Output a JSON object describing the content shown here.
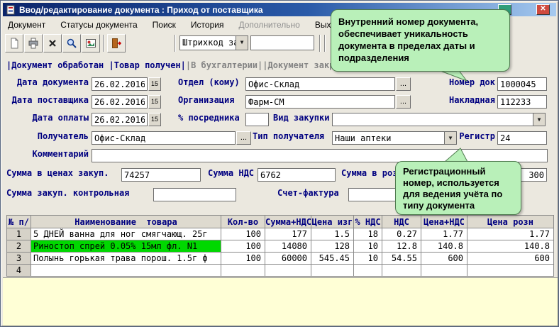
{
  "colors": {
    "label": "#000080",
    "highlight": "#00d800",
    "tooltip_bg": "#b9f0b9",
    "tooltip_border": "#4f7a4f",
    "panel": "#ffffd6",
    "flag_on": "#000080",
    "flag_off": "#848484"
  },
  "icons": {
    "dropdown_glyph": "▼",
    "close_glyph": "✕"
  },
  "window": {
    "title": "Ввод/редактирование документа : Приход от поставщика"
  },
  "menu": {
    "items": [
      {
        "label": "Документ",
        "enabled": true
      },
      {
        "label": "Статусы документа",
        "enabled": true
      },
      {
        "label": "Поиск",
        "enabled": true
      },
      {
        "label": "История",
        "enabled": true
      },
      {
        "label": "Дополнительно",
        "enabled": false
      },
      {
        "label": "Выход",
        "enabled": true
      }
    ]
  },
  "toolbar": {
    "icons": [
      "new-document",
      "print",
      "delete",
      "search",
      "report",
      "exit"
    ],
    "barcode_combo_value": "Штрихкод заво",
    "barcode_input_value": ""
  },
  "status_flags": {
    "processed": "|Документ обработан ",
    "received": "|Товар получен|",
    "accounting": "|В бухгалтерии|",
    "closed": "|Документ закрыт|"
  },
  "form": {
    "doc_date": {
      "label": "Дата документа",
      "value": "26.02.2016",
      "calendar": "15"
    },
    "supplier_date": {
      "label": "Дата поставщика",
      "value": "26.02.2016",
      "calendar": "15"
    },
    "pay_date": {
      "label": "Дата оплаты",
      "value": "26.02.2016",
      "calendar": "15"
    },
    "department": {
      "label": "Отдел (кому)",
      "value": "Офис-Склад",
      "browse": "..."
    },
    "organization": {
      "label": "Организация",
      "value": "Фарм-СМ",
      "browse": "..."
    },
    "middleman_pct": {
      "label": "% посредника",
      "value": ""
    },
    "purchase_kind": {
      "label": "Вид закупки",
      "value": ""
    },
    "receiver": {
      "label": "Получатель",
      "value": "Офис-Склад",
      "browse": "..."
    },
    "receiver_type": {
      "label": "Тип получателя",
      "value": "Наши аптеки"
    },
    "register": {
      "label": "Регистр",
      "value": "24"
    },
    "doc_number": {
      "label": "Номер док",
      "value": "1000045"
    },
    "invoice_number": {
      "label": "Накладная",
      "value": "112233"
    },
    "comment": {
      "label": "Комментарий",
      "value": ""
    },
    "purchase_sum": {
      "label": "Сумма в ценах закуп.",
      "value": "74257"
    },
    "nds_sum": {
      "label": "Сумма НДС",
      "value": "6762"
    },
    "retail_sum": {
      "label": "Сумма в розн. ценах",
      "value": "300"
    },
    "control_sum": {
      "label": "Сумма закуп. контрольная",
      "value": ""
    },
    "invoice_facture": {
      "label": "Счет-фактура",
      "value": ""
    }
  },
  "tooltips": {
    "doc_number": {
      "text": "Внутренний номер документа, обеспечивает уникальность документа в пределах даты и подразделения"
    },
    "register": {
      "text": "Регистрационный номер, используется для ведения учёта по типу документа"
    }
  },
  "table": {
    "columns": [
      "№ п/",
      "Наименование  товара",
      "Кол-во",
      "Сумма+НДС",
      "Цена изг",
      "% НДС",
      "НДС",
      "Цена+НДС",
      "Цена розн"
    ],
    "rows": [
      {
        "num": "1",
        "name": "5 ДНЕЙ ванна для ног смягчающ. 25г",
        "qty": "100",
        "sum_nds": "177",
        "price_mfg": "1.5",
        "pct_nds": "18",
        "nds": "0.27",
        "price_with_nds": "1.77",
        "price_retail": "1.77",
        "highlighted": false
      },
      {
        "num": "2",
        "name": "Риностоп спрей 0.05% 15мл фл. N1",
        "qty": "100",
        "sum_nds": "14080",
        "price_mfg": "128",
        "pct_nds": "10",
        "nds": "12.8",
        "price_with_nds": "140.8",
        "price_retail": "140.8",
        "highlighted": true
      },
      {
        "num": "3",
        "name": "Полынь горькая трава порош. 1.5г ф",
        "qty": "100",
        "sum_nds": "60000",
        "price_mfg": "545.45",
        "pct_nds": "10",
        "nds": "54.55",
        "price_with_nds": "600",
        "price_retail": "600",
        "highlighted": false
      },
      {
        "num": "4",
        "name": "",
        "qty": "",
        "sum_nds": "",
        "price_mfg": "",
        "pct_nds": "",
        "nds": "",
        "price_with_nds": "",
        "price_retail": "",
        "highlighted": false
      }
    ]
  }
}
